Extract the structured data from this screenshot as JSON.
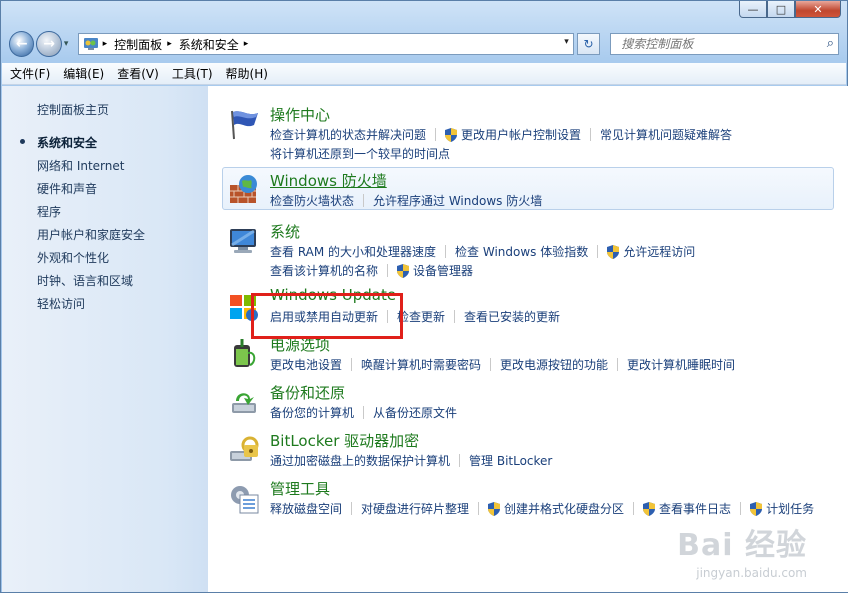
{
  "window": {
    "caption_buttons": {
      "minimize": "—",
      "maximize": "□",
      "close": "✕"
    }
  },
  "nav": {
    "back_glyph": "←",
    "forward_glyph": "→",
    "dropdown_glyph": "▾",
    "breadcrumbs": [
      "控制面板",
      "系统和安全"
    ],
    "crumb_separator": "▸",
    "refresh_glyph": "↻",
    "search_placeholder": "搜索控制面板",
    "search_glyph": "⌕"
  },
  "menu": [
    "文件(F)",
    "编辑(E)",
    "查看(V)",
    "工具(T)",
    "帮助(H)"
  ],
  "sidebar": {
    "home": "控制面板主页",
    "items": [
      {
        "label": "系统和安全",
        "active": true
      },
      {
        "label": "网络和 Internet"
      },
      {
        "label": "硬件和声音"
      },
      {
        "label": "程序"
      },
      {
        "label": "用户帐户和家庭安全"
      },
      {
        "label": "外观和个性化"
      },
      {
        "label": "时钟、语言和区域"
      },
      {
        "label": "轻松访问"
      }
    ]
  },
  "categories": [
    {
      "title": "操作中心",
      "icon": "action-center-flag-icon",
      "rows": [
        [
          {
            "t": "检查计算机的状态并解决问题"
          },
          {
            "t": "更改用户帐户控制设置",
            "shield": true
          },
          {
            "t": "常见计算机问题疑难解答"
          }
        ],
        [
          {
            "t": "将计算机还原到一个较早的时间点"
          }
        ]
      ]
    },
    {
      "title": "Windows 防火墙",
      "icon": "firewall-icon",
      "rows": [
        [
          {
            "t": "检查防火墙状态"
          },
          {
            "t": "允许程序通过 Windows 防火墙"
          }
        ]
      ]
    },
    {
      "title": "系统",
      "icon": "system-computer-icon",
      "rows": [
        [
          {
            "t": "查看 RAM 的大小和处理器速度"
          },
          {
            "t": "检查 Windows 体验指数"
          },
          {
            "t": "允许远程访问",
            "shield": true
          }
        ],
        [
          {
            "t": "查看该计算机的名称"
          },
          {
            "t": "设备管理器",
            "shield": true
          }
        ]
      ]
    },
    {
      "title": "Windows Update",
      "icon": "windows-update-icon",
      "rows": [
        [
          {
            "t": "启用或禁用自动更新"
          },
          {
            "t": "检查更新"
          },
          {
            "t": "查看已安装的更新"
          }
        ]
      ]
    },
    {
      "title": "电源选项",
      "icon": "power-options-icon",
      "rows": [
        [
          {
            "t": "更改电池设置"
          },
          {
            "t": "唤醒计算机时需要密码"
          },
          {
            "t": "更改电源按钮的功能"
          },
          {
            "t": "更改计算机睡眠时间"
          }
        ]
      ]
    },
    {
      "title": "备份和还原",
      "icon": "backup-restore-icon",
      "rows": [
        [
          {
            "t": "备份您的计算机"
          },
          {
            "t": "从备份还原文件"
          }
        ]
      ]
    },
    {
      "title": "BitLocker 驱动器加密",
      "icon": "bitlocker-icon",
      "rows": [
        [
          {
            "t": "通过加密磁盘上的数据保护计算机"
          },
          {
            "t": "管理 BitLocker"
          }
        ]
      ]
    },
    {
      "title": "管理工具",
      "icon": "admin-tools-icon",
      "rows": [
        [
          {
            "t": "释放磁盘空间"
          },
          {
            "t": "对硬盘进行碎片整理"
          },
          {
            "t": "创建并格式化硬盘分区",
            "shield": true
          },
          {
            "t": "查看事件日志",
            "shield": true
          },
          {
            "t": "计划任务",
            "shield": true
          }
        ]
      ]
    }
  ],
  "watermark": {
    "brand": "Bai 经验",
    "url": "jingyan.baidu.com"
  }
}
